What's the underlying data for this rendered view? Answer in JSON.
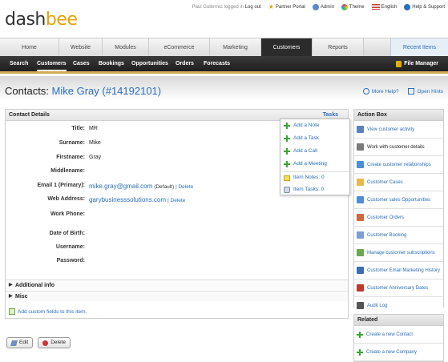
{
  "brand": {
    "part1": "dash",
    "part2": "bee"
  },
  "top_links": {
    "user_status": "Paul Gutierrez logged in",
    "logout": "Log out",
    "partner_portal": "Partner Portal",
    "admin": "Admin",
    "theme": "Theme",
    "language": "English",
    "help": "Help & Support"
  },
  "main_nav": {
    "tabs": [
      "Home",
      "Website",
      "Modules",
      "eCommerce",
      "Marketing",
      "Customers",
      "Reports"
    ],
    "active": "Customers",
    "recent_items": "Recent Items"
  },
  "sub_nav": {
    "items": [
      "Search",
      "Customers",
      "Cases",
      "Bookings",
      "Opportunities",
      "Orders",
      "Forecasts"
    ],
    "active": "Customers",
    "file_manager": "File Manager"
  },
  "page": {
    "title_prefix": "Contacts:",
    "contact_name": "Mike Gray (#14192101)",
    "more_help": "More Help?",
    "open_hints": "Open Hints"
  },
  "contact_details": {
    "header": "Contact Details",
    "tasks_link": "Tasks",
    "fields": {
      "title": {
        "label": "Title:",
        "value": "MR"
      },
      "surname": {
        "label": "Surname:",
        "value": "Mike"
      },
      "firstname": {
        "label": "Firstname:",
        "value": "Gray"
      },
      "middlename": {
        "label": "Middlename:",
        "value": ""
      },
      "email": {
        "label": "Email 1 (Primary):",
        "value": "mike.gray@gmail.com",
        "default_tag": "(Default)",
        "delete": "| Delete"
      },
      "web": {
        "label": "Web Address:",
        "value": "garybusinesssolutions.com",
        "delete": "| Delete"
      },
      "work_phone": {
        "label": "Work Phone:",
        "value": ""
      },
      "dob": {
        "label": "Date of Birth:",
        "value": ""
      },
      "username": {
        "label": "Username:",
        "value": ""
      },
      "password": {
        "label": "Password:",
        "value": ""
      }
    },
    "sections": {
      "additional": "Additional info",
      "misc": "Misc"
    },
    "add_custom": "Add custom fields to this item."
  },
  "tasks_menu": {
    "add_note": "Add a Note",
    "add_task": "Add a Task",
    "add_call": "Add a Call",
    "add_meeting": "Add a Meeting",
    "item_notes": "Item Notes: 0",
    "item_tasks": "Item Tasks: 0"
  },
  "buttons": {
    "edit": "Edit",
    "delete": "Delete"
  },
  "action_box": {
    "header": "Action Box",
    "items": [
      {
        "label": "View customer activity",
        "icon": "activity-icon",
        "color": "#5b7fbf"
      },
      {
        "label": "Work with customer details",
        "icon": "details-icon",
        "color": "#7a7a7a"
      },
      {
        "label": "Create customer relationships",
        "icon": "relationship-icon",
        "color": "#4d8fd6"
      },
      {
        "label": "Customer Cases",
        "icon": "cases-icon",
        "color": "#e8b84a"
      },
      {
        "label": "Customer sales Opportunities",
        "icon": "opportunities-icon",
        "color": "#4d8fd6"
      },
      {
        "label": "Customer Orders",
        "icon": "orders-icon",
        "color": "#d06a3a"
      },
      {
        "label": "Customer Booking",
        "icon": "booking-icon",
        "color": "#7a9ed6"
      },
      {
        "label": "Manage customer subscriptions",
        "icon": "subscriptions-icon",
        "color": "#6aa84f"
      },
      {
        "label": "Customer Email Marketing History",
        "icon": "email-icon",
        "color": "#3a6fb0"
      },
      {
        "label": "Customer Anniversary Dates",
        "icon": "calendar-icon",
        "color": "#c0392b"
      },
      {
        "label": "Audit Log",
        "icon": "audit-icon",
        "color": "#555555"
      }
    ]
  },
  "related": {
    "header": "Related",
    "items": [
      "Create a new Contact",
      "Create a new Company"
    ]
  },
  "colors": {
    "accent": "#2a6ebb",
    "brand_orange": "#e8a200",
    "subnav_bg": "#2b2b2b"
  }
}
